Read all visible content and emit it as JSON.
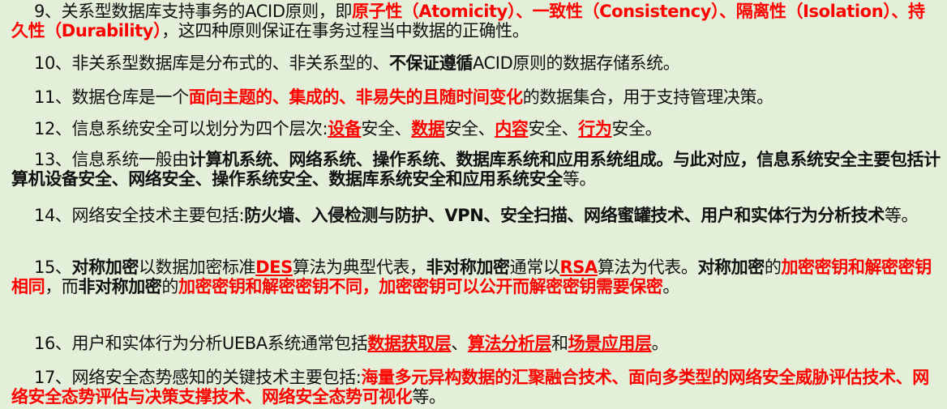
{
  "colors": {
    "background": "#e3efd9",
    "text": "#111111",
    "highlight": "#ff0000"
  },
  "paragraphs": [
    {
      "num": "9、",
      "segments": [
        {
          "text": "关系型数据库支持事务的ACID原则，即",
          "style": "normal"
        },
        {
          "text": "原子性（Atomicity）、一致性（Consistency）、隔离性（Isolation）、持久性（Durability）",
          "style": "red"
        },
        {
          "text": "，这四种原则保证在事务过程当中数据的正确性。",
          "style": "normal"
        }
      ]
    },
    {
      "num": "10、",
      "segments": [
        {
          "text": "非关系型数据库是分布式的、非关系型的、",
          "style": "normal"
        },
        {
          "text": "不保证遵循",
          "style": "bold"
        },
        {
          "text": "ACID原则的数据存储系统。",
          "style": "normal"
        }
      ]
    },
    {
      "num": "11、",
      "segments": [
        {
          "text": "数据仓库是一个",
          "style": "normal"
        },
        {
          "text": "面向主题的、集成的、非易失的且随时间变化",
          "style": "red"
        },
        {
          "text": "的数据集合，用于支持管理决策。",
          "style": "normal"
        }
      ]
    },
    {
      "num": "12、",
      "segments": [
        {
          "text": "信息系统安全可以划分为四个层次:",
          "style": "normal"
        },
        {
          "text": "设备",
          "style": "red-underline"
        },
        {
          "text": "安全、",
          "style": "normal"
        },
        {
          "text": "数据",
          "style": "red-underline"
        },
        {
          "text": "安全、",
          "style": "normal"
        },
        {
          "text": "内容",
          "style": "red-underline"
        },
        {
          "text": "安全、",
          "style": "normal"
        },
        {
          "text": "行为",
          "style": "red-underline"
        },
        {
          "text": "安全。",
          "style": "normal"
        }
      ]
    },
    {
      "num": "13、",
      "segments": [
        {
          "text": "信息系统一般由",
          "style": "normal"
        },
        {
          "text": "计算机系统、网络系统、操作系统、数据库系统和应用系统组成。与此对应，信息系统安全主要包括计算机设备安全、网络安全、操作系统安全、数据库系统安全和应用系统安全",
          "style": "bold"
        },
        {
          "text": "等。",
          "style": "normal"
        }
      ]
    },
    {
      "num": "14、",
      "segments": [
        {
          "text": "网络安全技术主要包括:",
          "style": "normal"
        },
        {
          "text": "防火墙、入侵检测与防护、VPN、安全扫描、网络蜜罐技术、用户和实体行为分析技术",
          "style": "bold"
        },
        {
          "text": "等。",
          "style": "normal"
        }
      ]
    },
    {
      "num": "15、",
      "segments": [
        {
          "text": "对称加密",
          "style": "bold"
        },
        {
          "text": "以数据加密标准",
          "style": "normal"
        },
        {
          "text": "DES",
          "style": "red-underline"
        },
        {
          "text": "算法为典型代表，",
          "style": "normal"
        },
        {
          "text": "非对称加密",
          "style": "bold"
        },
        {
          "text": "通常以",
          "style": "normal"
        },
        {
          "text": "RSA",
          "style": "red-underline"
        },
        {
          "text": "算法为代表。",
          "style": "normal"
        },
        {
          "text": "对称加密",
          "style": "bold"
        },
        {
          "text": "的",
          "style": "normal"
        },
        {
          "text": "加密密钥和解密密钥相同",
          "style": "red"
        },
        {
          "text": "，而",
          "style": "normal"
        },
        {
          "text": "非对称加密",
          "style": "bold"
        },
        {
          "text": "的",
          "style": "normal"
        },
        {
          "text": "加密密钥和解密密钥不同，加密密钥可以公开而解密密钥需要保密",
          "style": "red"
        },
        {
          "text": "。",
          "style": "normal"
        }
      ]
    },
    {
      "num": "16、",
      "segments": [
        {
          "text": "用户和实体行为分析UEBA系统通常包括",
          "style": "normal"
        },
        {
          "text": "数据获取层",
          "style": "red-underline"
        },
        {
          "text": "、",
          "style": "normal"
        },
        {
          "text": "算法分析层",
          "style": "red-underline"
        },
        {
          "text": "和",
          "style": "normal"
        },
        {
          "text": "场景应用层",
          "style": "red-underline"
        },
        {
          "text": "。",
          "style": "normal"
        }
      ]
    },
    {
      "num": "17、",
      "segments": [
        {
          "text": "网络安全态势感知的关键技术主要包括:",
          "style": "normal"
        },
        {
          "text": "海量多元异构数据的汇聚融合技术、面向多类型的网络安全威胁评估技术、网络安全态势评估与决策支撑技术、网络安全态势可视化",
          "style": "red"
        },
        {
          "text": "等。",
          "style": "normal"
        }
      ]
    }
  ]
}
